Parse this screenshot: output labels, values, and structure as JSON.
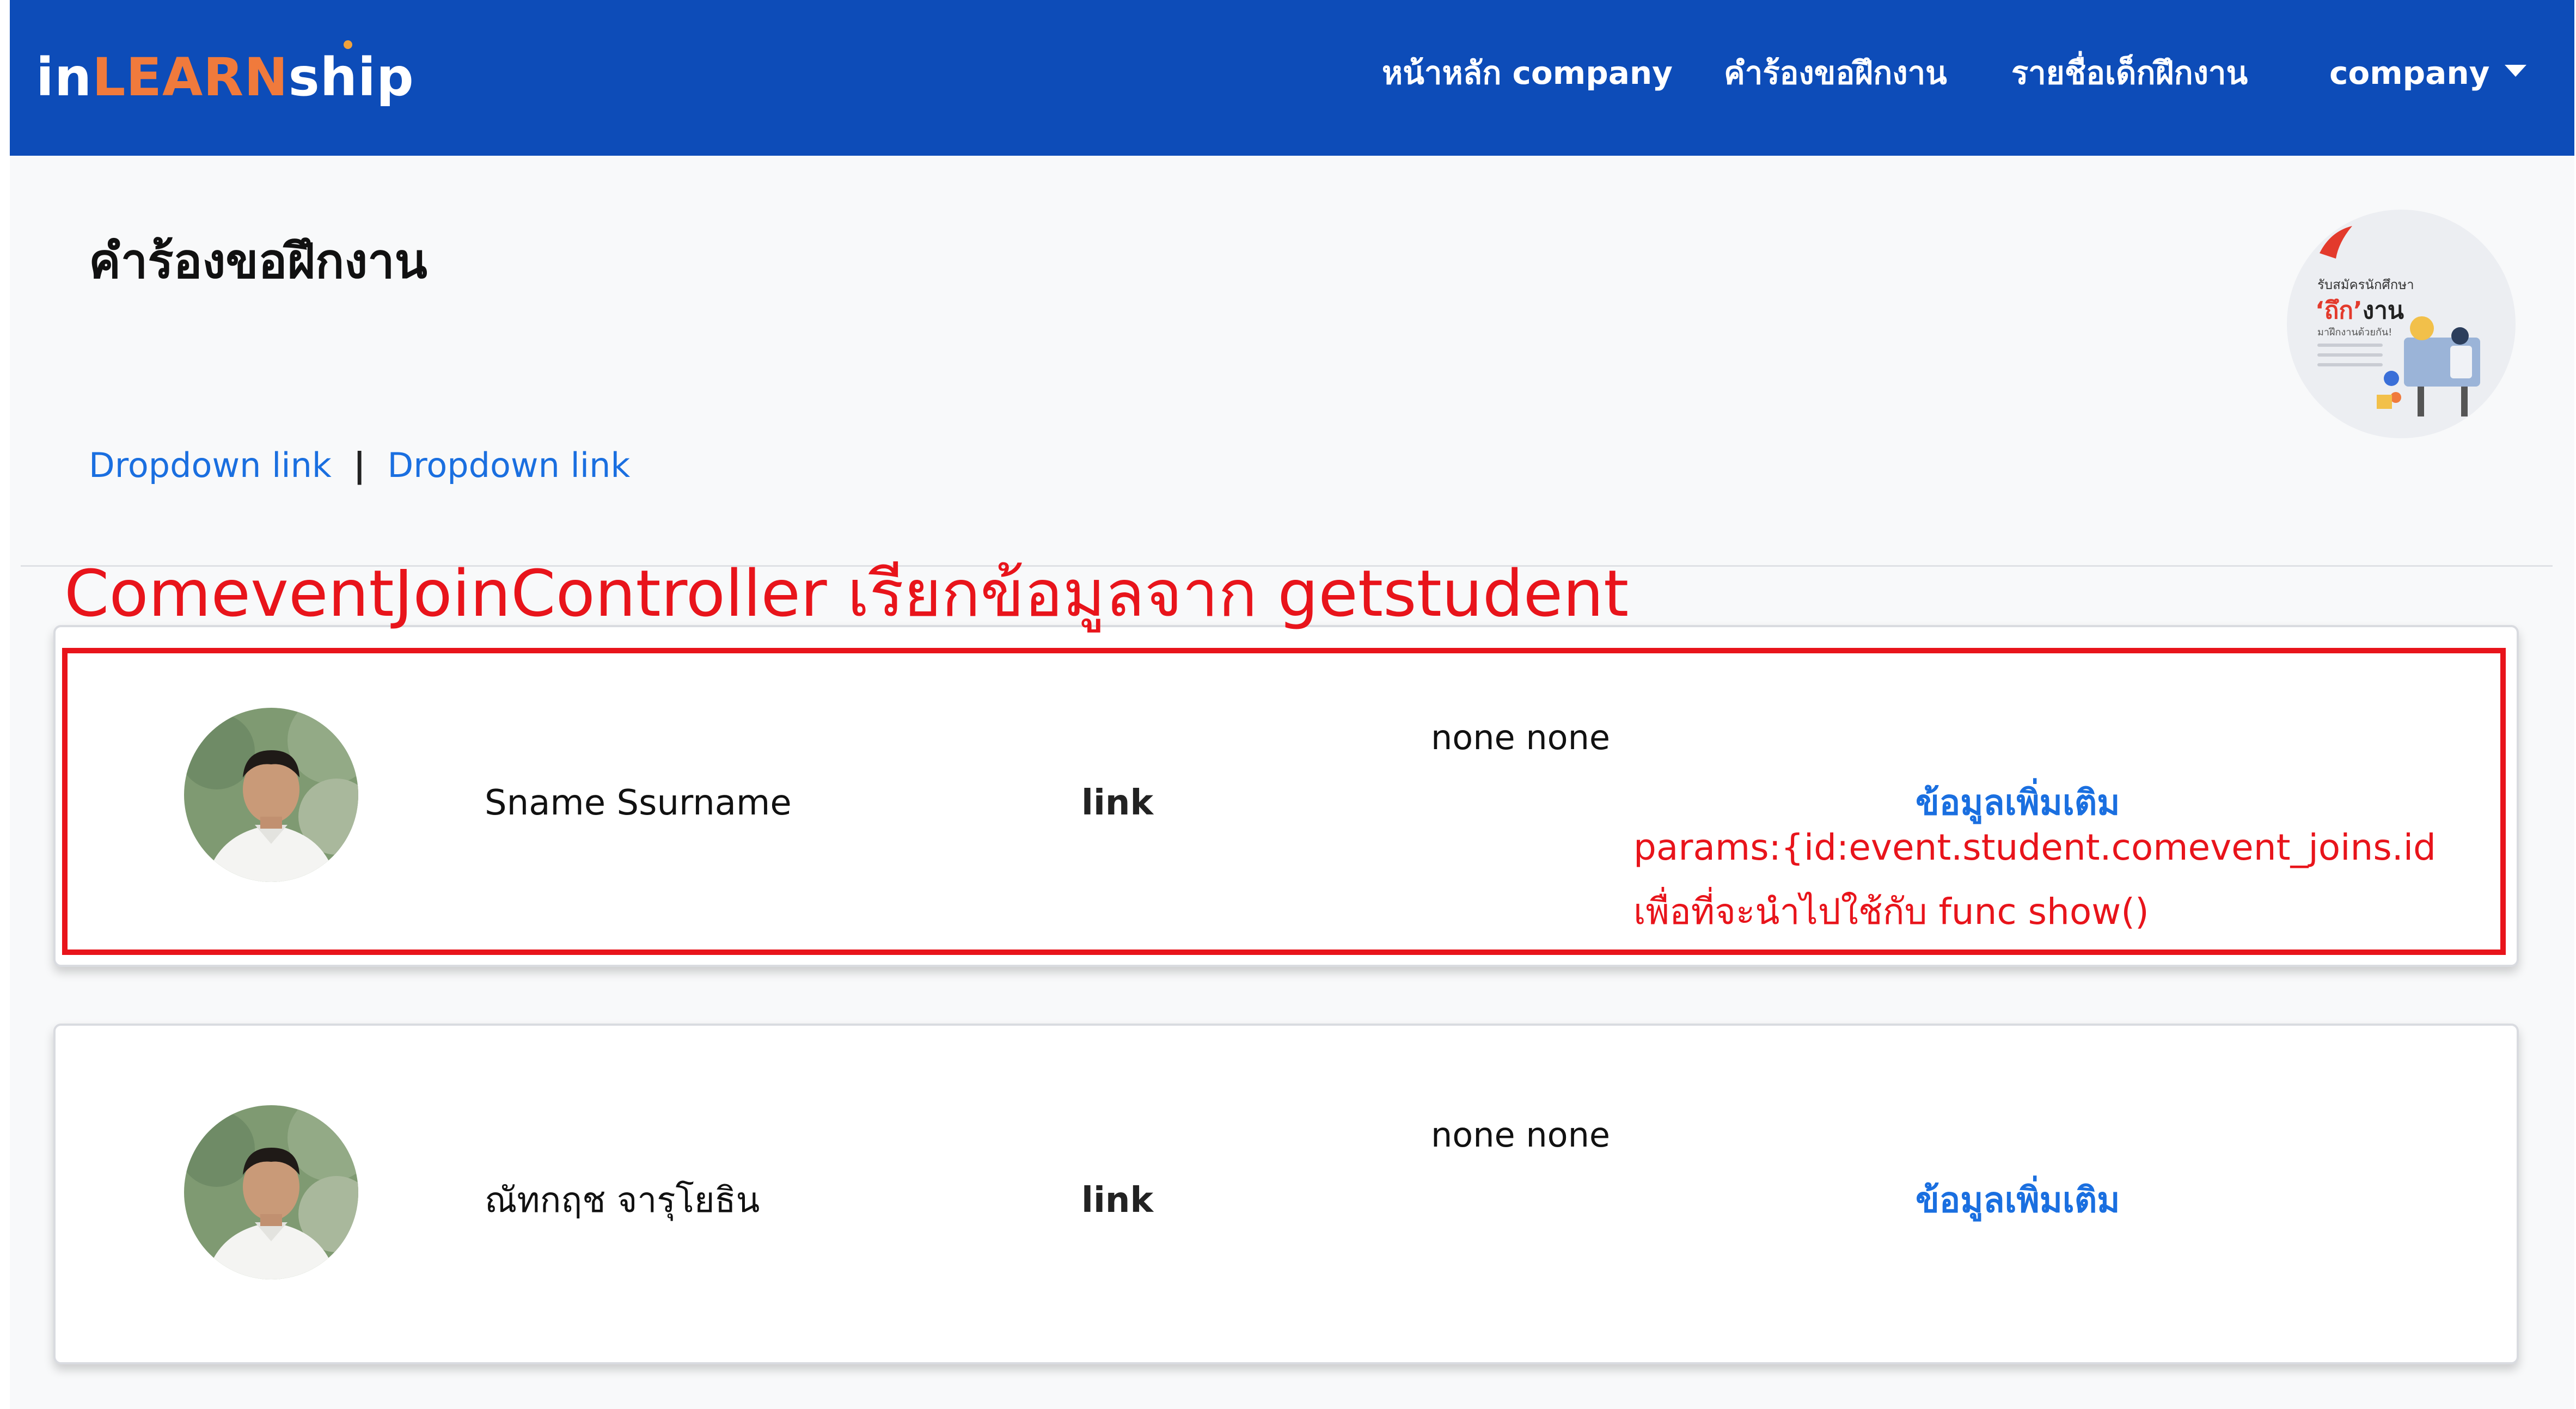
{
  "navbar": {
    "brand_part1": "in",
    "brand_part2": "LEARN",
    "brand_part3": "ship",
    "items": [
      {
        "label": "หน้าหลัก company"
      },
      {
        "label": "คำร้องขอฝึกงาน"
      },
      {
        "label": "รายชื่อเด็กฝึกงาน"
      },
      {
        "label": "company"
      }
    ]
  },
  "page": {
    "title": "คำร้องขอฝึกงาน",
    "links": [
      "Dropdown link",
      "Dropdown link"
    ],
    "link_separator": "|"
  },
  "promo_image": {
    "line1": "รับสมัครนักศึกษา",
    "line2_quoted": "‘ถึก’",
    "line2_rest": "งาน",
    "line3": "มาฝึกงานด้วยกัน!"
  },
  "annotations": {
    "title": "ComeventJoinController เรียกข้อมูลจาก getstudent",
    "params": "params:{id:event.student.comevent_joins.id",
    "usage": "เพื่อที่จะนำไปใช้กับ func show()"
  },
  "students": [
    {
      "name": "Sname Ssurname",
      "link_label": "link",
      "status": "none none",
      "more_label": "ข้อมูลเพิ่มเติม"
    },
    {
      "name": "ณัทกฤช จารุโยธิน",
      "link_label": "link",
      "status": "none none",
      "more_label": "ข้อมูลเพิ่มเติม"
    }
  ],
  "colors": {
    "navbar": "#0d4cb8",
    "brand_accent": "#f07a3c",
    "link_blue": "#1a6fe0",
    "annotation_red": "#e8141b"
  }
}
